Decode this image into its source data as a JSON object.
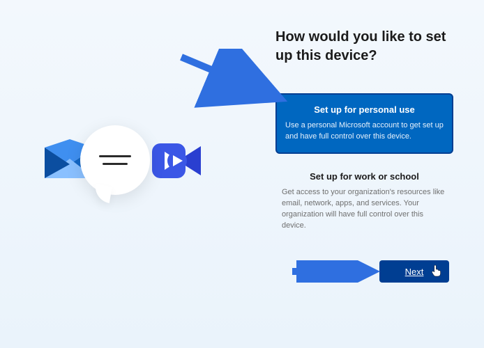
{
  "heading": "How would you like to set up this device?",
  "options": {
    "personal": {
      "title": "Set up for personal use",
      "description": "Use a personal Microsoft account to get set up and have full control over this device."
    },
    "work": {
      "title": "Set up for work or school",
      "description": "Get access to your organization's resources like email, network, apps, and services. Your organization will have full control over this device."
    }
  },
  "buttons": {
    "next": "Next"
  },
  "colors": {
    "accent": "#0067c0",
    "accent_dark": "#003e92",
    "arrow": "#2f6fe0"
  }
}
